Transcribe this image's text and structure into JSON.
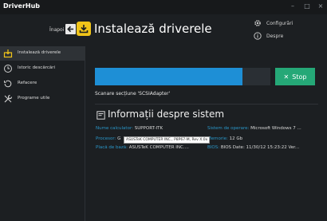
{
  "app": {
    "title": "DriverHub"
  },
  "window_controls": {
    "minimize": "–",
    "maximize": "□",
    "close": "×"
  },
  "header": {
    "back_label": "Înapoi",
    "page_title": "Instalează driverele",
    "links": [
      {
        "label": "Configurări",
        "icon": "gear-icon"
      },
      {
        "label": "Despre",
        "icon": "info-icon"
      }
    ]
  },
  "sidebar": {
    "items": [
      {
        "label": "Instalează driverele",
        "icon": "install-icon",
        "active": true
      },
      {
        "label": "Istoric descărcări",
        "icon": "history-icon",
        "active": false
      },
      {
        "label": "Refacere",
        "icon": "restore-icon",
        "active": false
      },
      {
        "label": "Programe utile",
        "icon": "tools-icon",
        "active": false
      }
    ]
  },
  "scan": {
    "progress": 0.84,
    "stop_label": "Stop",
    "status": "Scanare secțiune 'SCSIAdapter'"
  },
  "system_info": {
    "title": "Informații despre sistem",
    "left": [
      {
        "key": "Nume calculator:",
        "value": "SUPPORT-ITK"
      },
      {
        "key": "Procesor:",
        "value": "G"
      },
      {
        "key": "Placă de bază:",
        "value": "ASUSTeK COMPUTER INC...."
      }
    ],
    "right": [
      {
        "key": "Sistem de operare:",
        "value": "Microsoft Windows 7 ..."
      },
      {
        "key": "Memorie:",
        "value": "12 Gb"
      },
      {
        "key": "BIOS:",
        "value": "BIOS Date: 11/30/12 15:23:22 Ver..."
      }
    ],
    "tooltip": "ASUSTeK COMPUTER INC., P8P67-M, Rev X.0x"
  },
  "colors": {
    "accent_yellow": "#f0c419",
    "progress_blue": "#1e8fd6",
    "stop_green": "#25a877",
    "info_key_blue": "#2a97c9"
  }
}
